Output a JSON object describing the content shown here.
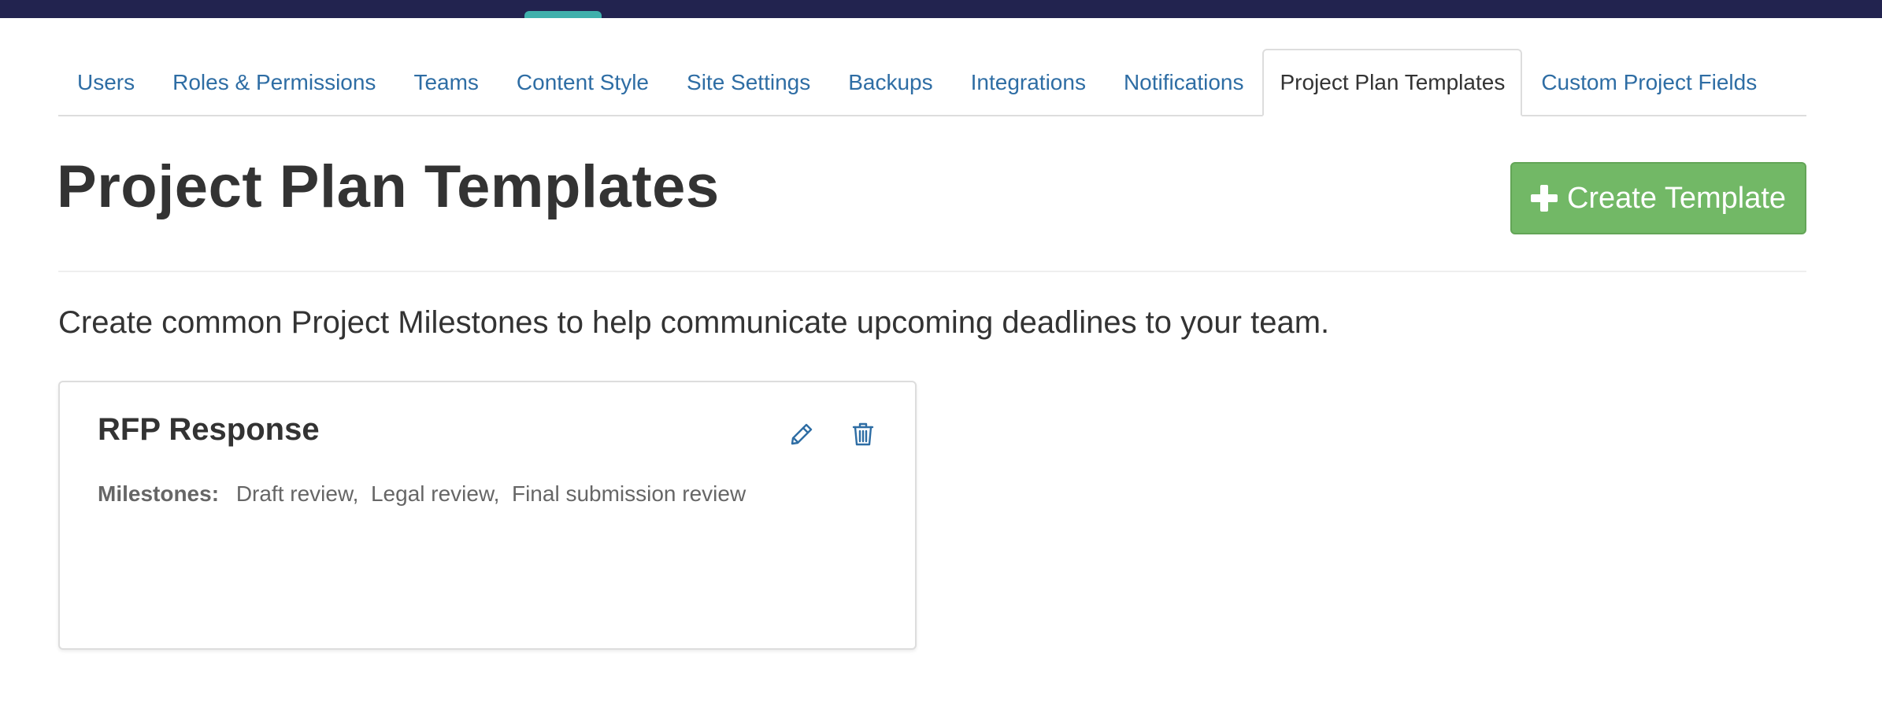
{
  "tabs": [
    {
      "label": "Users"
    },
    {
      "label": "Roles & Permissions"
    },
    {
      "label": "Teams"
    },
    {
      "label": "Content Style"
    },
    {
      "label": "Site Settings"
    },
    {
      "label": "Backups"
    },
    {
      "label": "Integrations"
    },
    {
      "label": "Notifications"
    },
    {
      "label": "Project Plan Templates",
      "active": true
    },
    {
      "label": "Custom Project Fields"
    }
  ],
  "page": {
    "title": "Project Plan Templates",
    "create_button_label": "Create Template",
    "description": "Create common Project Milestones to help communicate upcoming deadlines to your team."
  },
  "templates": [
    {
      "title": "RFP Response",
      "milestones_label": "Milestones:",
      "milestones": [
        "Draft review,",
        "Legal review,",
        "Final submission review"
      ]
    }
  ],
  "colors": {
    "topbar": "#22234f",
    "topbar_accent": "#3fb0ac",
    "link": "#2e6da4",
    "create_button": "#72b866"
  },
  "icons": {
    "create": "plus-icon",
    "edit": "pencil-icon",
    "delete": "trash-icon"
  }
}
